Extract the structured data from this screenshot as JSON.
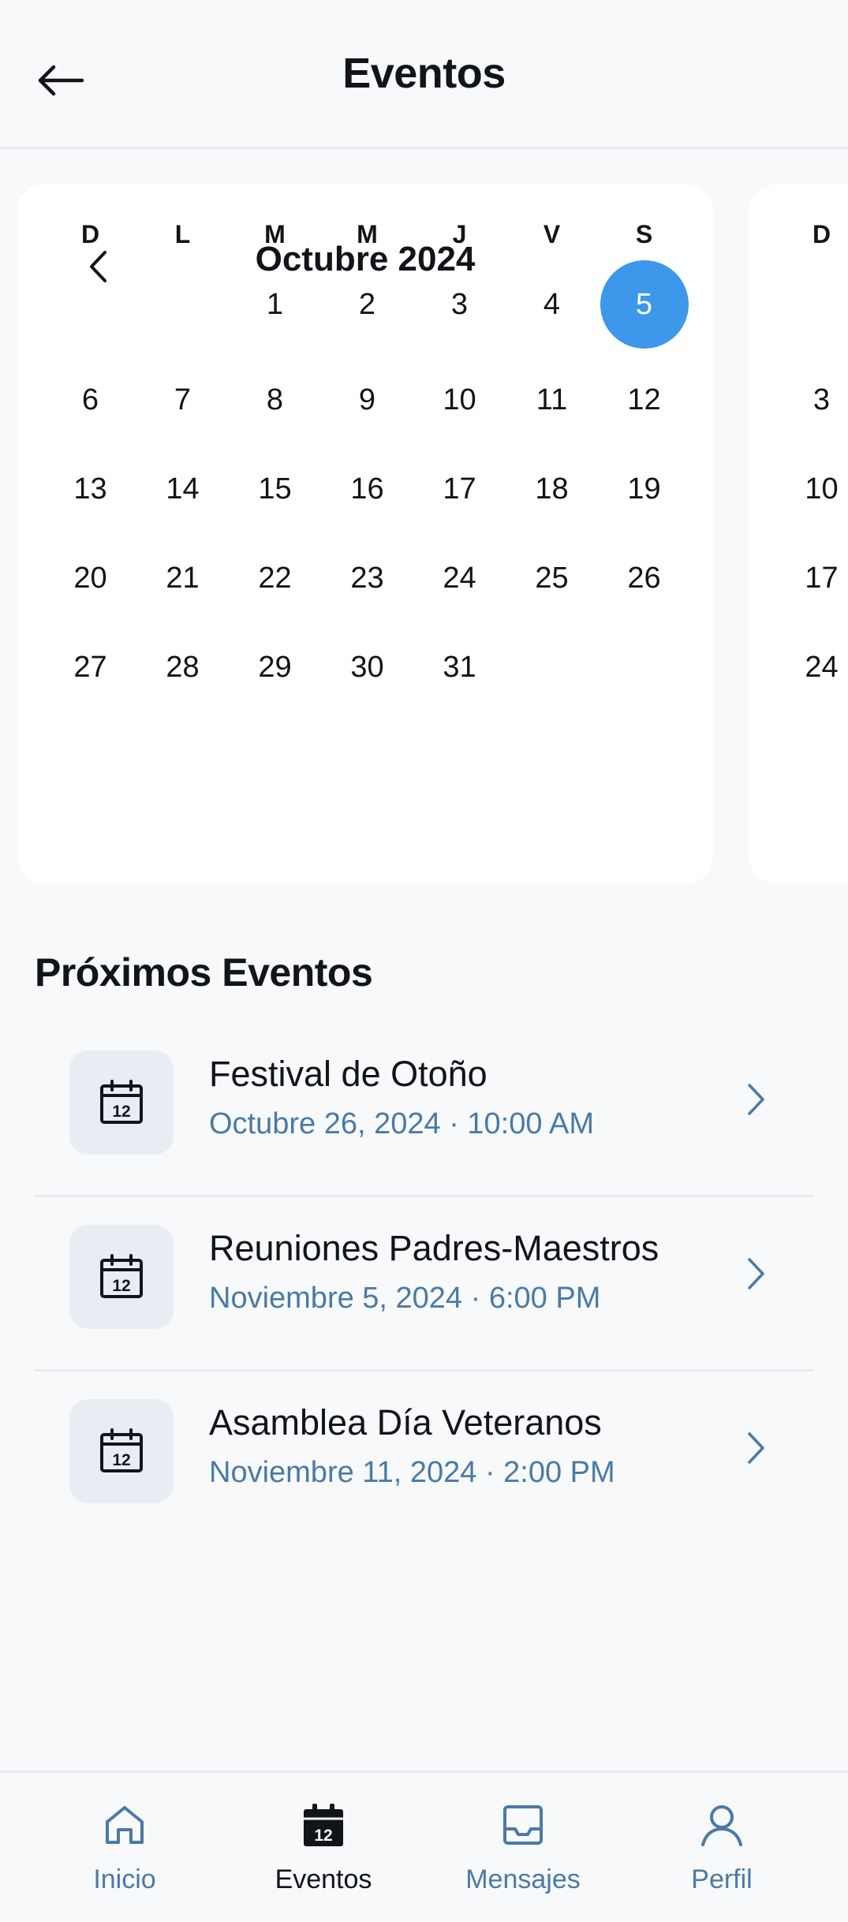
{
  "header": {
    "title": "Eventos"
  },
  "calendar": {
    "month_title": "Octubre 2024",
    "weekdays": [
      "D",
      "L",
      "M",
      "M",
      "J",
      "V",
      "S"
    ],
    "weeks": [
      [
        "",
        "",
        "1",
        "2",
        "3",
        "4",
        "5"
      ],
      [
        "6",
        "7",
        "8",
        "9",
        "10",
        "11",
        "12"
      ],
      [
        "13",
        "14",
        "15",
        "16",
        "17",
        "18",
        "19"
      ],
      [
        "20",
        "21",
        "22",
        "23",
        "24",
        "25",
        "26"
      ],
      [
        "27",
        "28",
        "29",
        "30",
        "31",
        "",
        ""
      ]
    ],
    "selected_day": "5",
    "accent_color": "#3d97ea"
  },
  "next_calendar": {
    "weekday_first": "D",
    "first_column_days": [
      "",
      "3",
      "10",
      "17",
      "24"
    ]
  },
  "upcoming": {
    "section_title": "Próximos Eventos",
    "events": [
      {
        "title": "Festival de Otoño",
        "date": "Octubre 26, 2024 · 10:00 AM",
        "icon": "calendar-12-icon"
      },
      {
        "title": "Reuniones Padres-Maestros",
        "date": "Noviembre 5, 2024 · 6:00 PM",
        "icon": "calendar-12-icon"
      },
      {
        "title": "Asamblea Día Veteranos",
        "date": "Noviembre 11, 2024 · 2:00 PM",
        "icon": "calendar-12-icon"
      }
    ]
  },
  "nav": {
    "items": [
      {
        "label": "Inicio",
        "icon": "home-icon",
        "active": false
      },
      {
        "label": "Eventos",
        "icon": "calendar-icon",
        "active": true
      },
      {
        "label": "Mensajes",
        "icon": "inbox-icon",
        "active": false
      },
      {
        "label": "Perfil",
        "icon": "user-icon",
        "active": false
      }
    ],
    "active_color": "#111418",
    "inactive_color": "#4a7aa6"
  }
}
